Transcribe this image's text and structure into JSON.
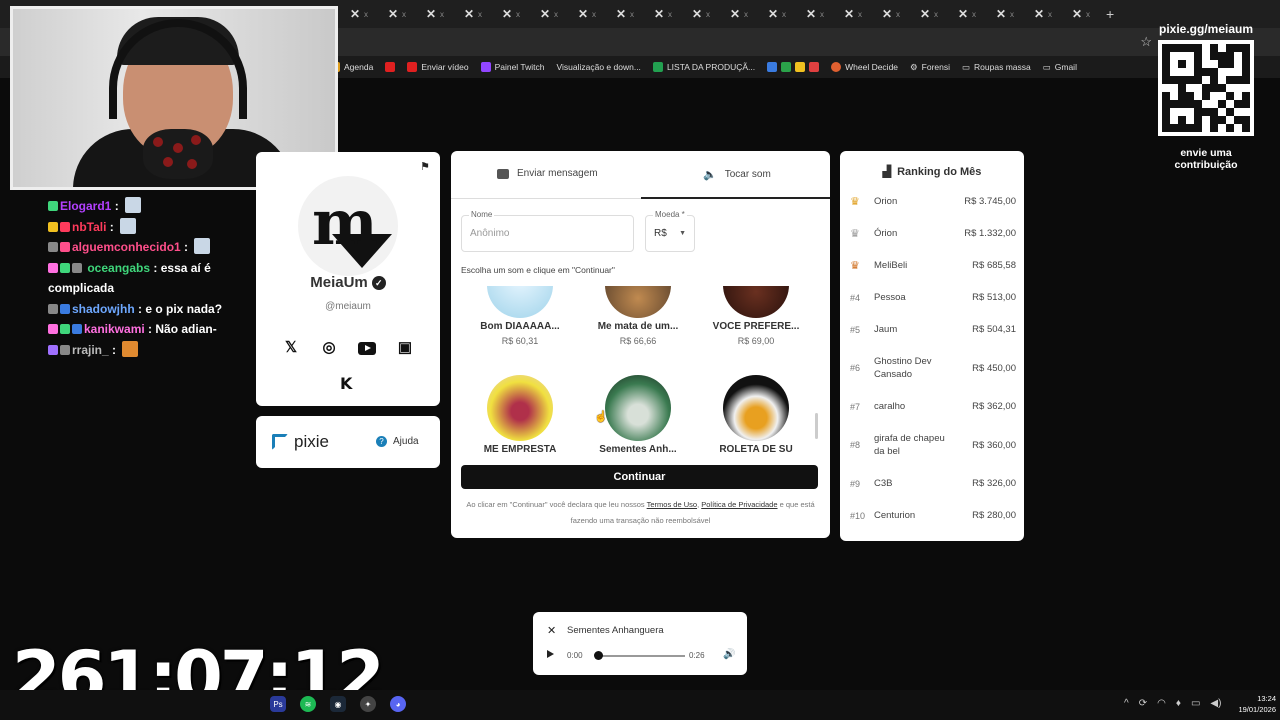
{
  "bookmarks": [
    "Agenda",
    "Enviar vídeo",
    "Painel Twitch",
    "Visualização e down...",
    "LISTA DA PRODUÇÃ...",
    "Wheel Decide",
    "Forensi",
    "Roupas massa",
    "Gmail"
  ],
  "chat": [
    {
      "user": "Elogard1",
      "message": "",
      "color": "#b340ff"
    },
    {
      "user": "nbTali",
      "message": "",
      "color": "#ff3b5c"
    },
    {
      "user": "alguemconhecido1",
      "message": "",
      "color": "#ff4f8b"
    },
    {
      "user": "oceangabs",
      "message": "essa aí é complicada",
      "color": "#3fd67b"
    },
    {
      "user": "shadowjhh",
      "message": "e o pix nada?",
      "color": "#6ea8ff"
    },
    {
      "user": "kanikwami",
      "message": "Não adian-",
      "color": "#ff70e0"
    },
    {
      "user": "rrajin_",
      "message": "",
      "color": "#bbbbbb"
    }
  ],
  "timer": "261:07:12",
  "profile": {
    "name": "MeiaUm",
    "handle": "@meiaum"
  },
  "pixie": {
    "brand": "pixie",
    "help": "Ajuda"
  },
  "form": {
    "tab_message": "Enviar mensagem",
    "tab_sound": "Tocar som",
    "name_label": "Nome",
    "name_placeholder": "Anônimo",
    "currency_label": "Moeda *",
    "currency_value": "R$",
    "hint": "Escolha um som e clique em \"Continuar\"",
    "continue": "Continuar",
    "terms_pre": "Ao clicar em \"Continuar\" você declara que leu nossos",
    "terms_link": "Termos de Uso",
    "privacy_link": "Política de Privacidade",
    "terms_post": "e que está fazendo uma transação não reembolsável"
  },
  "sounds": [
    {
      "name": "Bom DIAAAAA...",
      "price": "R$ 60,31"
    },
    {
      "name": "Me mata de um...",
      "price": "R$ 66,66"
    },
    {
      "name": "VOCE PREFERE...",
      "price": "R$ 69,00"
    },
    {
      "name": "ME EMPRESTA",
      "price": ""
    },
    {
      "name": "Sementes Anh...",
      "price": ""
    },
    {
      "name": "ROLETA DE SU",
      "price": ""
    }
  ],
  "ranking": {
    "title": "Ranking do Mês",
    "rows": [
      {
        "pos": "",
        "crown": "gold",
        "name": "Orion",
        "amount": "R$ 3.745,00"
      },
      {
        "pos": "",
        "crown": "silver",
        "name": "Órion",
        "amount": "R$ 1.332,00"
      },
      {
        "pos": "",
        "crown": "bronze",
        "name": "MeliBeli",
        "amount": "R$ 685,58"
      },
      {
        "pos": "#4",
        "name": "Pessoa",
        "amount": "R$ 513,00"
      },
      {
        "pos": "#5",
        "name": "Jaum",
        "amount": "R$ 504,31"
      },
      {
        "pos": "#6",
        "name": "Ghostino Dev Cansado",
        "amount": "R$ 450,00"
      },
      {
        "pos": "#7",
        "name": "caralho",
        "amount": "R$ 362,00"
      },
      {
        "pos": "#8",
        "name": "girafa de chapeu da bel",
        "amount": "R$ 360,00"
      },
      {
        "pos": "#9",
        "name": "C3B",
        "amount": "R$ 326,00"
      },
      {
        "pos": "#10",
        "name": "Centurion",
        "amount": "R$ 280,00"
      }
    ]
  },
  "qr": {
    "title": "pixie.gg/meiaum",
    "subtitle": "envie uma contribuição"
  },
  "player": {
    "title": "Sementes Anhanguera",
    "current": "0:00",
    "duration": "0:26",
    "progress": 0
  },
  "clock": {
    "time": "13:24",
    "date": "19/01/2026"
  }
}
